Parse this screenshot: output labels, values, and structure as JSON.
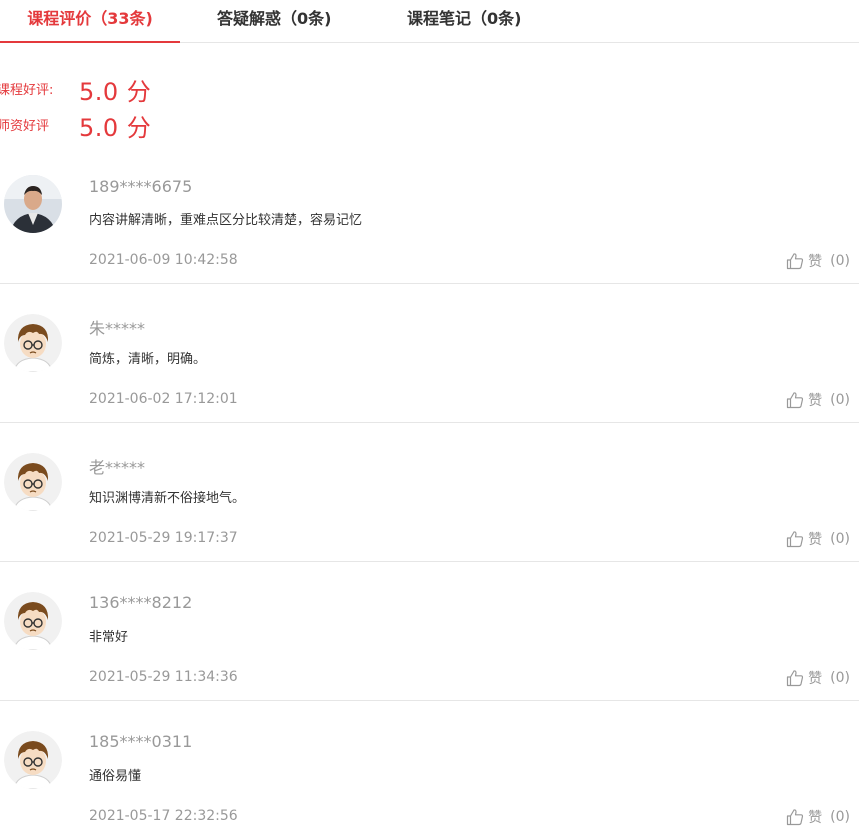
{
  "tabs": [
    {
      "label": "课程评价（33条)",
      "active": true
    },
    {
      "label": "答疑解惑（0条)",
      "active": false
    },
    {
      "label": "课程笔记（0条)",
      "active": false
    }
  ],
  "scores": {
    "course_label": "课程好评:",
    "course_value": "5.0 分",
    "teacher_label": "师资好评",
    "teacher_value": "5.0 分"
  },
  "like_label": "赞",
  "reviews": [
    {
      "user": "189****6675",
      "content": "内容讲解清晰，重难点区分比较清楚，容易记忆",
      "time": "2021-06-09 10:42:58",
      "likes": "(0)",
      "avatar": "photo-avatar"
    },
    {
      "user": "朱*****",
      "content": "简炼，清晰，明确。",
      "time": "2021-06-02 17:12:01",
      "likes": "(0)",
      "avatar": "cartoon-boy-avatar"
    },
    {
      "user": "老*****",
      "content": "知识渊博清新不俗接地气。",
      "time": "2021-05-29 19:17:37",
      "likes": "(0)",
      "avatar": "cartoon-boy-avatar"
    },
    {
      "user": "136****8212",
      "content": "非常好",
      "time": "2021-05-29 11:34:36",
      "likes": "(0)",
      "avatar": "cartoon-boy-avatar"
    },
    {
      "user": "185****0311",
      "content": "通俗易懂",
      "time": "2021-05-17 22:32:56",
      "likes": "(0)",
      "avatar": "cartoon-boy-avatar"
    }
  ],
  "colors": {
    "accent": "#e4393c",
    "muted": "#999999",
    "divider": "#e6e6e6"
  }
}
